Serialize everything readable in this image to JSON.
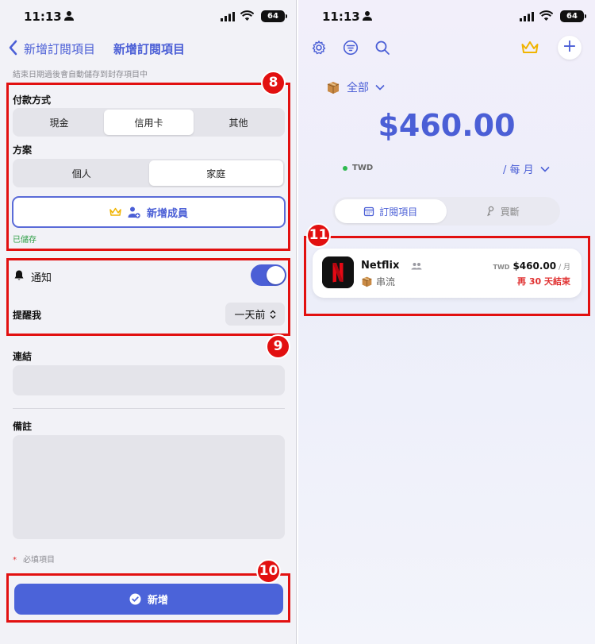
{
  "left": {
    "status": {
      "time": "11:13",
      "battery": "64"
    },
    "nav": {
      "back_label": "新增訂閱項目",
      "title": "新增訂閱項目"
    },
    "hint": "結束日期過後會自動儲存到封存項目中",
    "payment": {
      "label": "付款方式",
      "options": [
        "現金",
        "信用卡",
        "其他"
      ],
      "selected": "信用卡"
    },
    "plan": {
      "label": "方案",
      "options": [
        "個人",
        "家庭"
      ],
      "selected": "家庭"
    },
    "add_member_label": "新增成員",
    "saved_text": "已儲存",
    "notification": {
      "label": "通知",
      "enabled": true
    },
    "remind": {
      "label": "提醒我",
      "value": "一天前"
    },
    "link": {
      "label": "連結",
      "value": ""
    },
    "notes": {
      "label": "備註",
      "value": ""
    },
    "required_note": {
      "star": "*",
      "text": "必填項目"
    },
    "add_button_label": "新增"
  },
  "right": {
    "status": {
      "time": "11:13",
      "battery": "64"
    },
    "filter_label": "全部",
    "total": "$460.00",
    "currency": "TWD",
    "period": "/ 每 月",
    "tabs": [
      {
        "label": "訂閱項目",
        "icon": "calendar-icon"
      },
      {
        "label": "買斷",
        "icon": "key-icon"
      }
    ],
    "subscription": {
      "name": "Netflix",
      "category": "串流",
      "currency": "TWD",
      "price": "$460.00",
      "per": "/ 月",
      "expiry": "再 30 天結束"
    }
  },
  "annotations": {
    "b8": "8",
    "b9": "9",
    "b10": "10",
    "b11": "11",
    "color": "#e21010"
  },
  "colors": {
    "accent": "#4b5fd6",
    "button": "#4b63d9",
    "success": "#2e9f46",
    "danger": "#e03131"
  }
}
